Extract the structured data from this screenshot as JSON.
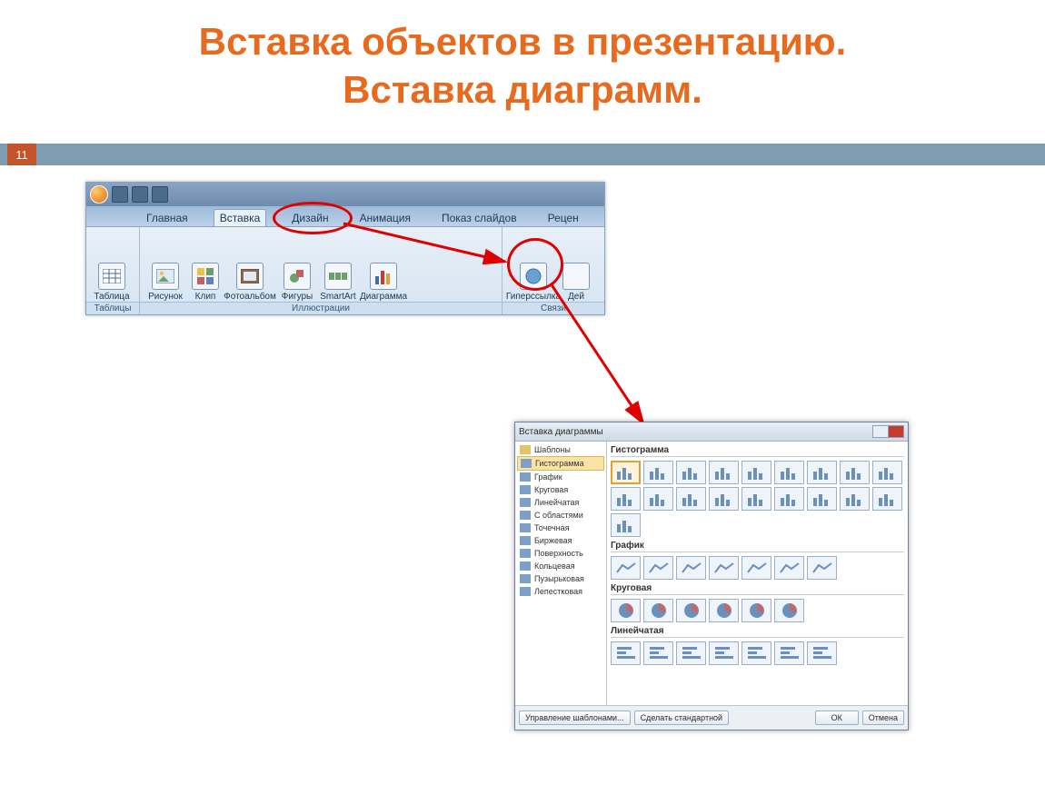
{
  "page_number": "11",
  "title_line1": "Вставка объектов в презентацию.",
  "title_line2": "Вставка диаграмм.",
  "ribbon": {
    "tabs": [
      "Главная",
      "Вставка",
      "Дизайн",
      "Анимация",
      "Показ слайдов",
      "Рецен"
    ],
    "active_tab_index": 1,
    "groups": [
      {
        "label": "Таблицы",
        "buttons": [
          "Таблица"
        ]
      },
      {
        "label": "Иллюстрации",
        "buttons": [
          "Рисунок",
          "Клип",
          "Фотоальбом",
          "Фигуры",
          "SmartArt",
          "Диаграмма"
        ]
      },
      {
        "label": "Связи",
        "buttons": [
          "Гиперссылка",
          "Дей"
        ]
      }
    ]
  },
  "dialog": {
    "title": "Вставка диаграммы",
    "side_items": [
      "Шаблоны",
      "Гистограмма",
      "График",
      "Круговая",
      "Линейчатая",
      "С областями",
      "Точечная",
      "Биржевая",
      "Поверхность",
      "Кольцевая",
      "Пузырьковая",
      "Лепестковая"
    ],
    "side_selected_index": 1,
    "categories": [
      {
        "name": "Гистограмма",
        "count": 19,
        "selected_index": 0
      },
      {
        "name": "График",
        "count": 7
      },
      {
        "name": "Круговая",
        "count": 6
      },
      {
        "name": "Линейчатая",
        "count": 7
      }
    ],
    "footer": {
      "manage": "Управление шаблонами...",
      "default": "Сделать стандартной",
      "ok": "ОК",
      "cancel": "Отмена"
    }
  }
}
